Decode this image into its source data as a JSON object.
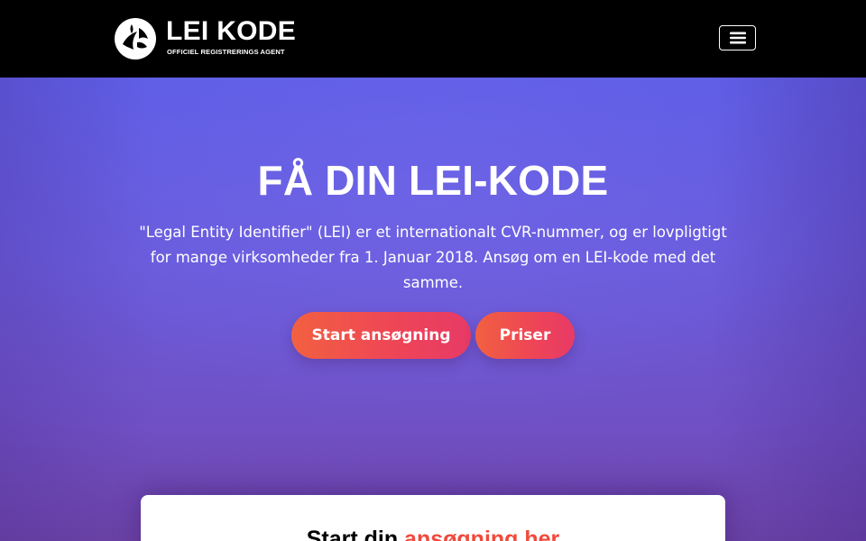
{
  "header": {
    "logo": {
      "icon": "lei-kode-logo-mark",
      "title": "LEI KODE",
      "subtitle": "OFFICIEL REGISTRERINGS AGENT"
    },
    "menu_toggle_icon": "hamburger-menu-icon"
  },
  "hero": {
    "title": "FÅ DIN LEI-KODE",
    "description": "\"Legal Entity Identifier\" (LEI) er et internationalt CVR-nummer, og er lovpligtigt for mange virksomheder fra 1. Januar 2018. Ansøg om en LEI-kode med det samme.",
    "buttons": {
      "start": "Start ansøgning",
      "prices": "Priser"
    }
  },
  "card": {
    "heading_start": "Start din ",
    "heading_accent": "ansøgning her"
  },
  "colors": {
    "navbar_bg": "#000000",
    "hero_top": "#5f5ee6",
    "hero_bottom": "#6c43a6",
    "button_gradient_start": "#f26040",
    "button_gradient_end": "#e83a66",
    "accent_text": "#f04a3c"
  }
}
